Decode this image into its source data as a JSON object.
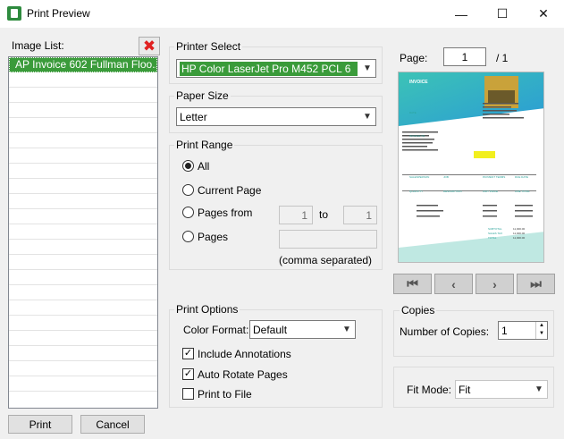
{
  "window": {
    "title": "Print Preview",
    "minimize": "—",
    "maximize": "☐",
    "close": "✕"
  },
  "image_list": {
    "label": "Image List:",
    "items": [
      "AP Invoice 602 Fullman Floo..."
    ]
  },
  "printer_select": {
    "title": "Printer Select",
    "value": "HP Color LaserJet Pro M452 PCL 6"
  },
  "paper_size": {
    "title": "Paper Size",
    "value": "Letter"
  },
  "print_range": {
    "title": "Print Range",
    "all": "All",
    "current_page": "Current Page",
    "pages_from": "Pages from",
    "from_value": "1",
    "to_label": "to",
    "to_value": "1",
    "pages": "Pages",
    "pages_value": "",
    "hint": "(comma separated)"
  },
  "print_options": {
    "title": "Print Options",
    "color_format_label": "Color Format:",
    "color_format_value": "Default",
    "include_annotations": "Include Annotations",
    "auto_rotate": "Auto Rotate Pages",
    "print_to_file": "Print to File"
  },
  "page": {
    "label": "Page:",
    "value": "1",
    "total": "/ 1"
  },
  "preview": {
    "invoice_title": "INVOICE",
    "date_label": "DATE",
    "invoice_to": "INVOICE TO",
    "salesperson": "SALESPERSON",
    "job": "JOB",
    "payment_terms": "PAYMENT TERMS",
    "due_date": "DUE DATE",
    "quantity": "QUANTITY",
    "description": "DESCRIPTION",
    "unit_price": "UNIT PRICE",
    "line_total": "LINE TOTAL",
    "subtotal": "SUBTOTAL",
    "sales_tax": "SALES TAX",
    "total": "TOTAL",
    "subtotal_value": "11,000.00",
    "sales_tax_value": "11,000.00",
    "total_value": "11,000.00"
  },
  "nav": {
    "first": "⏮",
    "prev": "‹",
    "next": "›",
    "last": "⏭"
  },
  "copies": {
    "title": "Copies",
    "label": "Number of Copies:",
    "value": "1"
  },
  "fit_mode": {
    "label": "Fit Mode:",
    "value": "Fit"
  },
  "buttons": {
    "print": "Print",
    "cancel": "Cancel"
  },
  "colors": {
    "accent": "#3a9b3a",
    "preview_teal": "#2cb9b0"
  }
}
